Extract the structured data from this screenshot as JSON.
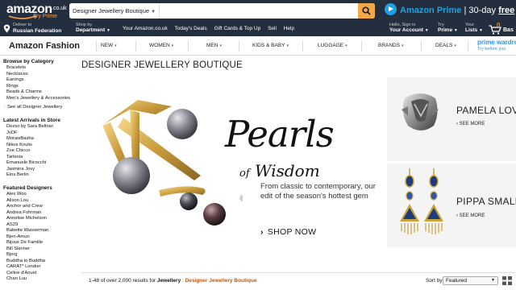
{
  "header": {
    "logo_word": "amazon",
    "logo_domain": ".co.uk",
    "logo_sub": "Try Prime",
    "search_category": "Designer Jewellery Boutique",
    "prime_brand": "Amazon Prime",
    "prime_sep": " | 30-day ",
    "prime_free": "free trial"
  },
  "nav": {
    "deliver_line1": "Deliver to",
    "deliver_line2": "Russian Federation",
    "shopby_line1": "Shop by",
    "shopby_line2": "Department",
    "links": [
      "Your Amazon.co.uk",
      "Today's Deals",
      "Gift Cards & Top Up",
      "Sell",
      "Help"
    ],
    "account_line1": "Hello, Sign in",
    "account_line2": "Your Account",
    "try_line1": "Try",
    "try_line2": "Prime",
    "lists_line1": "Your",
    "lists_line2": "Lists",
    "cart_count": "0",
    "cart_label": "Bas"
  },
  "store": {
    "title": "Amazon Fashion",
    "menu": [
      "NEW",
      "WOMEN",
      "MEN",
      "KIDS & BABY",
      "LUGGAGE",
      "BRANDS",
      "DEALS"
    ],
    "pw_line1": "prime wardro",
    "pw_line2": "Try before you"
  },
  "sidebar": {
    "browse_heading": "Browse by Category",
    "categories": [
      "Bracelets",
      "Necklaces",
      "Earrings",
      "Rings",
      "Beads & Charms",
      "Men's Jewellery & Accessories"
    ],
    "see_all": "See all Designer Jewellery",
    "latest_heading": "Latest Arrivals in Store",
    "latest": [
      "Dezso by Sara Beltran",
      "JvDF",
      "MoraisBasha",
      "Nikos Koulis",
      "Zoe Chicco",
      "Tartesia",
      "Emanuele Bicocchi",
      "Jasmina Jovy",
      "Eins Berlin"
    ],
    "featured_heading": "Featured Designers",
    "featured": [
      "Alex Woo",
      "Alison Lou",
      "Anchor and Crew",
      "Andrea Fohrman",
      "Annelise Michelson",
      "AS29",
      "Babette Wasserman",
      "Bjen-Amun",
      "Bijoux De Famille",
      "Bill Skinner",
      "Bjorg",
      "Buddha to Buddha",
      "CARAT* London",
      "Celine d'Aoust",
      "Chan Luu"
    ]
  },
  "main": {
    "title": "DESIGNER JEWELLERY BOUTIQUE",
    "hero": {
      "headline": "Pearls",
      "subline_of": "of",
      "subline": "Wisdom",
      "tagline": "From classic to contemporary, our edit of the season's hottest gem",
      "cta": "SHOP NOW"
    },
    "cards": [
      {
        "name": "PAMELA LOVE",
        "more": "SEE MORE"
      },
      {
        "name": "PIPPA SMALL",
        "more": "SEE MORE"
      }
    ]
  },
  "results": {
    "count_text": "1-48 of over 2,000 results for ",
    "dept": "Jewellery",
    "sep": " : ",
    "store": "Designer Jewellery Boutique",
    "sort_label": "Sort by",
    "sort_value": "Featured"
  },
  "colors": {
    "header_bg": "#232f3e",
    "search_button": "#f3a847",
    "prime_blue": "#1fa0e3",
    "result_orange": "#c45500"
  }
}
